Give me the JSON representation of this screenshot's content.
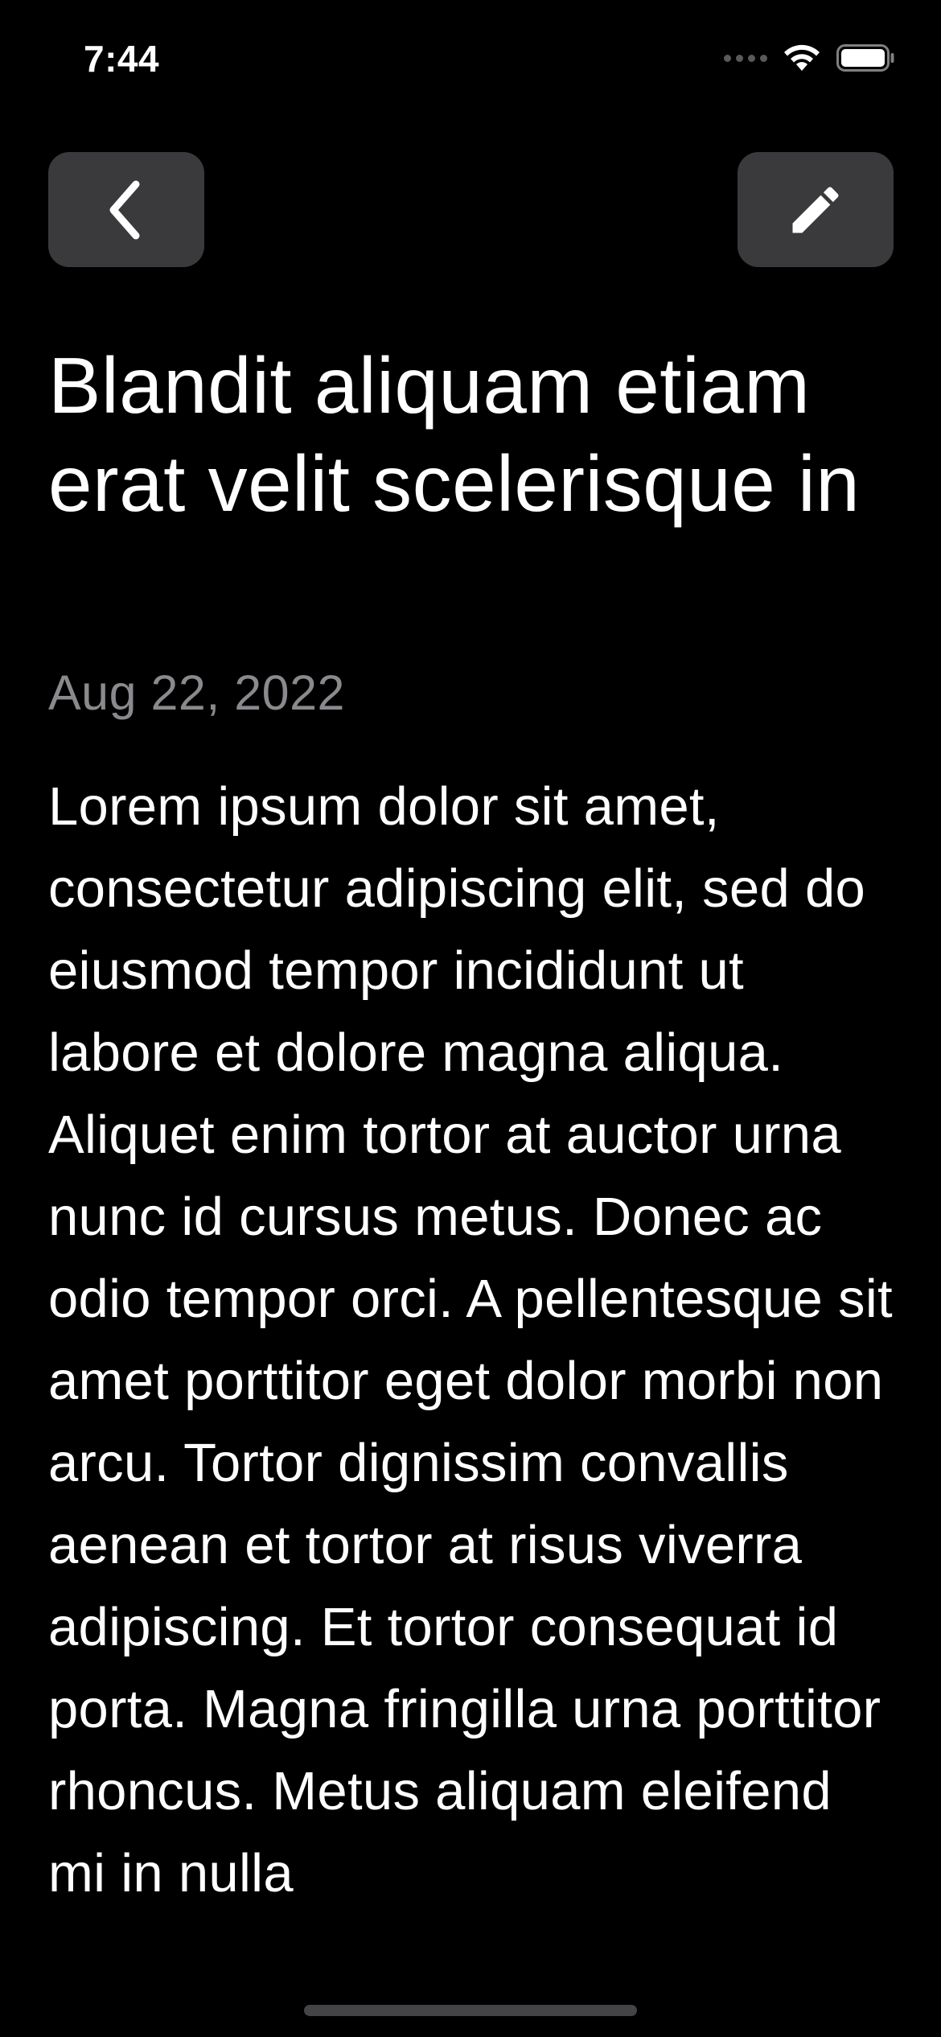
{
  "status_bar": {
    "time": "7:44"
  },
  "icons": {
    "back": "chevron-left-icon",
    "edit": "pencil-icon",
    "wifi": "wifi-icon",
    "battery": "battery-icon",
    "signal": "cellular-signal-icon"
  },
  "colors": {
    "background": "#000000",
    "button_bg": "#3a3a3c",
    "date_text": "#8a8a8e",
    "body_text": "#ffffff"
  },
  "note": {
    "title": "Blandit aliquam etiam erat velit scelerisque in",
    "date": "Aug 22, 2022",
    "body": "Lorem ipsum dolor sit amet, consectetur adipiscing elit, sed do eiusmod tempor incididunt ut labore et dolore magna aliqua. Aliquet enim tortor at auctor urna nunc id cursus metus. Donec ac odio tempor orci. A pellentesque sit amet porttitor eget dolor morbi non arcu. Tortor dignissim convallis aenean et tortor at risus viverra adipiscing. Et tortor consequat id porta. Magna fringilla urna porttitor rhoncus. Metus aliquam eleifend mi in nulla"
  }
}
